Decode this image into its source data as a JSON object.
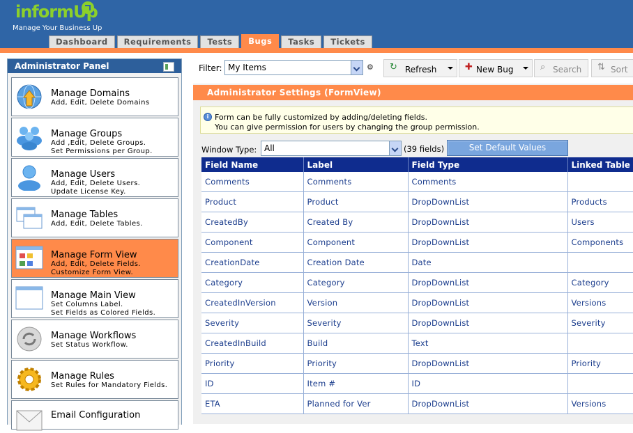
{
  "app": {
    "logo": "informUp",
    "tagline": "Manage Your Business Up",
    "tabs": [
      {
        "label": "Dashboard",
        "active": false
      },
      {
        "label": "Requirements",
        "active": false
      },
      {
        "label": "Tests",
        "active": false
      },
      {
        "label": "Bugs",
        "active": true
      },
      {
        "label": "Tasks",
        "active": false
      },
      {
        "label": "Tickets",
        "active": false
      }
    ],
    "colors": {
      "header": "#2f65a6",
      "accent": "#ff8a4a",
      "logo": "#8cd02b",
      "table_header": "#0f2c8e"
    }
  },
  "sidebar": {
    "title": "Administrator Panel",
    "items": [
      {
        "name": "Manage Domains",
        "desc1": "Add, Edit, Delete Domains",
        "desc2": "",
        "icon": "globe-arrow-icon",
        "active": false
      },
      {
        "name": "Manage Groups",
        "desc1": "Add ,Edit, Delete Groups.",
        "desc2": "Set Permissions per Group.",
        "icon": "user-group-icon",
        "active": false
      },
      {
        "name": "Manage Users",
        "desc1": "Add, Edit, Delete Users.",
        "desc2": "Update License Key.",
        "icon": "user-icon",
        "active": false
      },
      {
        "name": "Manage Tables",
        "desc1": "Add, Edit, Delete Tables.",
        "desc2": "",
        "icon": "tables-icon",
        "active": false
      },
      {
        "name": "Manage Form View",
        "desc1": "Add, Edit, Delete Fields.",
        "desc2": "Customize Form View.",
        "icon": "form-view-icon",
        "active": true
      },
      {
        "name": "Manage Main View",
        "desc1": "Set Columns Label.",
        "desc2": "Set Fields as Colored Fields.",
        "icon": "main-view-icon",
        "active": false
      },
      {
        "name": "Manage Workflows",
        "desc1": "Set Status Workflow.",
        "desc2": "",
        "icon": "workflow-icon",
        "active": false
      },
      {
        "name": "Manage Rules",
        "desc1": "Set Rules for Mandatory Fields.",
        "desc2": "",
        "icon": "gear-icon",
        "active": false
      },
      {
        "name": "Email Configuration",
        "desc1": "",
        "desc2": "",
        "icon": "envelope-icon",
        "active": false
      }
    ]
  },
  "toolbar": {
    "filter_label": "Filter:",
    "filter_value": "My Items",
    "refresh_label": "Refresh",
    "new_bug_label": "New Bug",
    "search_label": "Search",
    "sort_label": "Sort"
  },
  "main": {
    "title": "Administrator Settings  (FormView)",
    "info_line1": "Form can be fully customized by adding/deleting fields.",
    "info_line2": "You can give permission for users by changing the group permission.",
    "window_type_label": "Window Type:",
    "window_type_value": "All",
    "field_count": "(39 fields)",
    "default_button": "Set Default Values",
    "columns": [
      "Field Name",
      "Label",
      "Field Type",
      "Linked Table"
    ],
    "rows": [
      [
        "Comments",
        "Comments",
        "Comments",
        ""
      ],
      [
        "Product",
        "Product",
        "DropDownList",
        "Products"
      ],
      [
        "CreatedBy",
        "Created By",
        "DropDownList",
        "Users"
      ],
      [
        "Component",
        "Component",
        "DropDownList",
        "Components"
      ],
      [
        "CreationDate",
        "Creation Date",
        "Date",
        ""
      ],
      [
        "Category",
        "Category",
        "DropDownList",
        "Category"
      ],
      [
        "CreatedInVersion",
        "Version",
        "DropDownList",
        "Versions"
      ],
      [
        "Severity",
        "Severity",
        "DropDownList",
        "Severity"
      ],
      [
        "CreatedInBuild",
        "Build",
        "Text",
        ""
      ],
      [
        "Priority",
        "Priority",
        "DropDownList",
        "Priority"
      ],
      [
        "ID",
        "Item #",
        "ID",
        ""
      ],
      [
        "ETA",
        "Planned for Ver",
        "DropDownList",
        "Versions"
      ]
    ]
  }
}
